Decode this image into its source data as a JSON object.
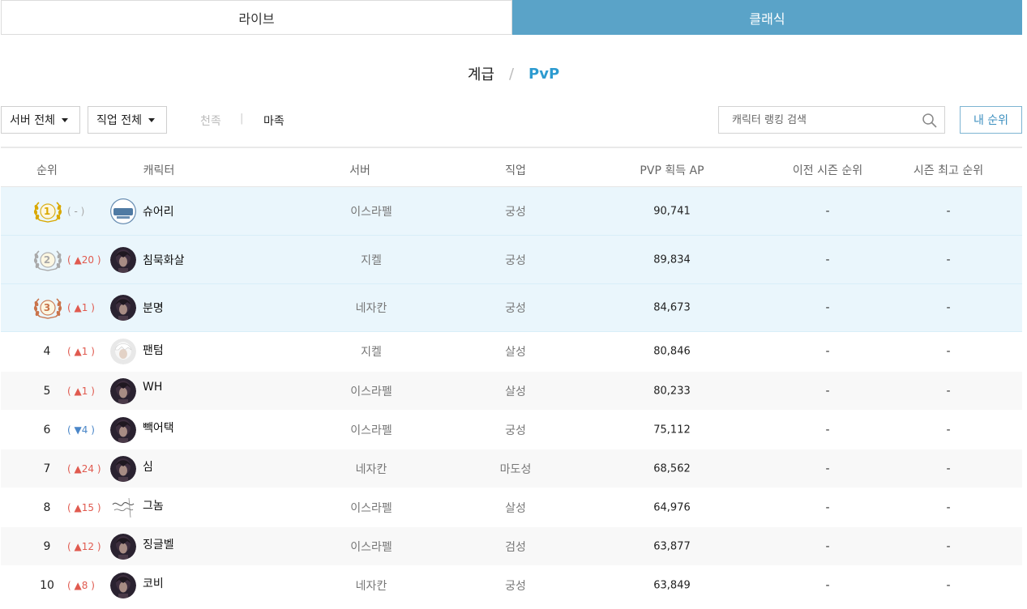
{
  "top_tabs": [
    {
      "label": "라이브",
      "active": false
    },
    {
      "label": "클래식",
      "active": true
    }
  ],
  "sub_tabs": {
    "grade": "계급",
    "separator": "/",
    "pvp": "PvP"
  },
  "filters": {
    "server_select": "서버 전체",
    "class_select": "직업 전체",
    "race_heaven": "천족",
    "race_divider": "|",
    "race_demon": "마족",
    "search_placeholder": "캐릭터 랭킹 검색",
    "my_rank_button": "내 순위"
  },
  "colors": {
    "accent": "#5aa3c8",
    "pvp_blue": "#2d9bd0",
    "up_red": "#e05a4f",
    "down_blue": "#4a86c8",
    "gold": "#d9a800",
    "silver": "#a9a9a9",
    "bronze": "#c9734a"
  },
  "table": {
    "headers": [
      "순위",
      "캐릭터",
      "서버",
      "직업",
      "PVP 획득 AP",
      "이전 시즌 순위",
      "시즌 최고 순위"
    ],
    "rows": [
      {
        "rank": "1",
        "change_dir": "none",
        "change": "-",
        "avatar": "guild-logo-avatar",
        "avatar_text": "슈어리",
        "name": "슈어리",
        "server": "이스라펠",
        "class": "궁성",
        "ap": "90,741",
        "prev": "-",
        "best": "-"
      },
      {
        "rank": "2",
        "change_dir": "up",
        "change": "20",
        "avatar": "dark-portrait-avatar",
        "name": "침묵화살",
        "server": "지켈",
        "class": "궁성",
        "ap": "89,834",
        "prev": "-",
        "best": "-"
      },
      {
        "rank": "3",
        "change_dir": "up",
        "change": "1",
        "avatar": "dark-portrait-avatar",
        "name": "분명",
        "server": "네자칸",
        "class": "궁성",
        "ap": "84,673",
        "prev": "-",
        "best": "-"
      },
      {
        "rank": "4",
        "change_dir": "up",
        "change": "1",
        "avatar": "white-hair-portrait-avatar",
        "name": "팬텀",
        "server": "지켈",
        "class": "살성",
        "ap": "80,846",
        "prev": "-",
        "best": "-"
      },
      {
        "rank": "5",
        "change_dir": "up",
        "change": "1",
        "avatar": "dark-portrait-avatar",
        "name": "WH",
        "server": "이스라펠",
        "class": "살성",
        "ap": "80,233",
        "prev": "-",
        "best": "-"
      },
      {
        "rank": "6",
        "change_dir": "down",
        "change": "4",
        "avatar": "dark-portrait-avatar",
        "name": "빽어택",
        "server": "이스라펠",
        "class": "궁성",
        "ap": "75,112",
        "prev": "-",
        "best": "-"
      },
      {
        "rank": "7",
        "change_dir": "up",
        "change": "24",
        "avatar": "dark-portrait-avatar",
        "name": "심",
        "server": "네자칸",
        "class": "마도성",
        "ap": "68,562",
        "prev": "-",
        "best": "-"
      },
      {
        "rank": "8",
        "change_dir": "up",
        "change": "15",
        "avatar": "script-logo-avatar",
        "name": "그놈",
        "server": "이스라펠",
        "class": "살성",
        "ap": "64,976",
        "prev": "-",
        "best": "-"
      },
      {
        "rank": "9",
        "change_dir": "up",
        "change": "12",
        "avatar": "dark-portrait-avatar",
        "name": "징글벨",
        "server": "이스라펠",
        "class": "검성",
        "ap": "63,877",
        "prev": "-",
        "best": "-"
      },
      {
        "rank": "10",
        "change_dir": "up",
        "change": "8",
        "avatar": "dark-portrait-avatar",
        "name": "코비",
        "server": "네자칸",
        "class": "궁성",
        "ap": "63,849",
        "prev": "-",
        "best": "-"
      }
    ]
  }
}
